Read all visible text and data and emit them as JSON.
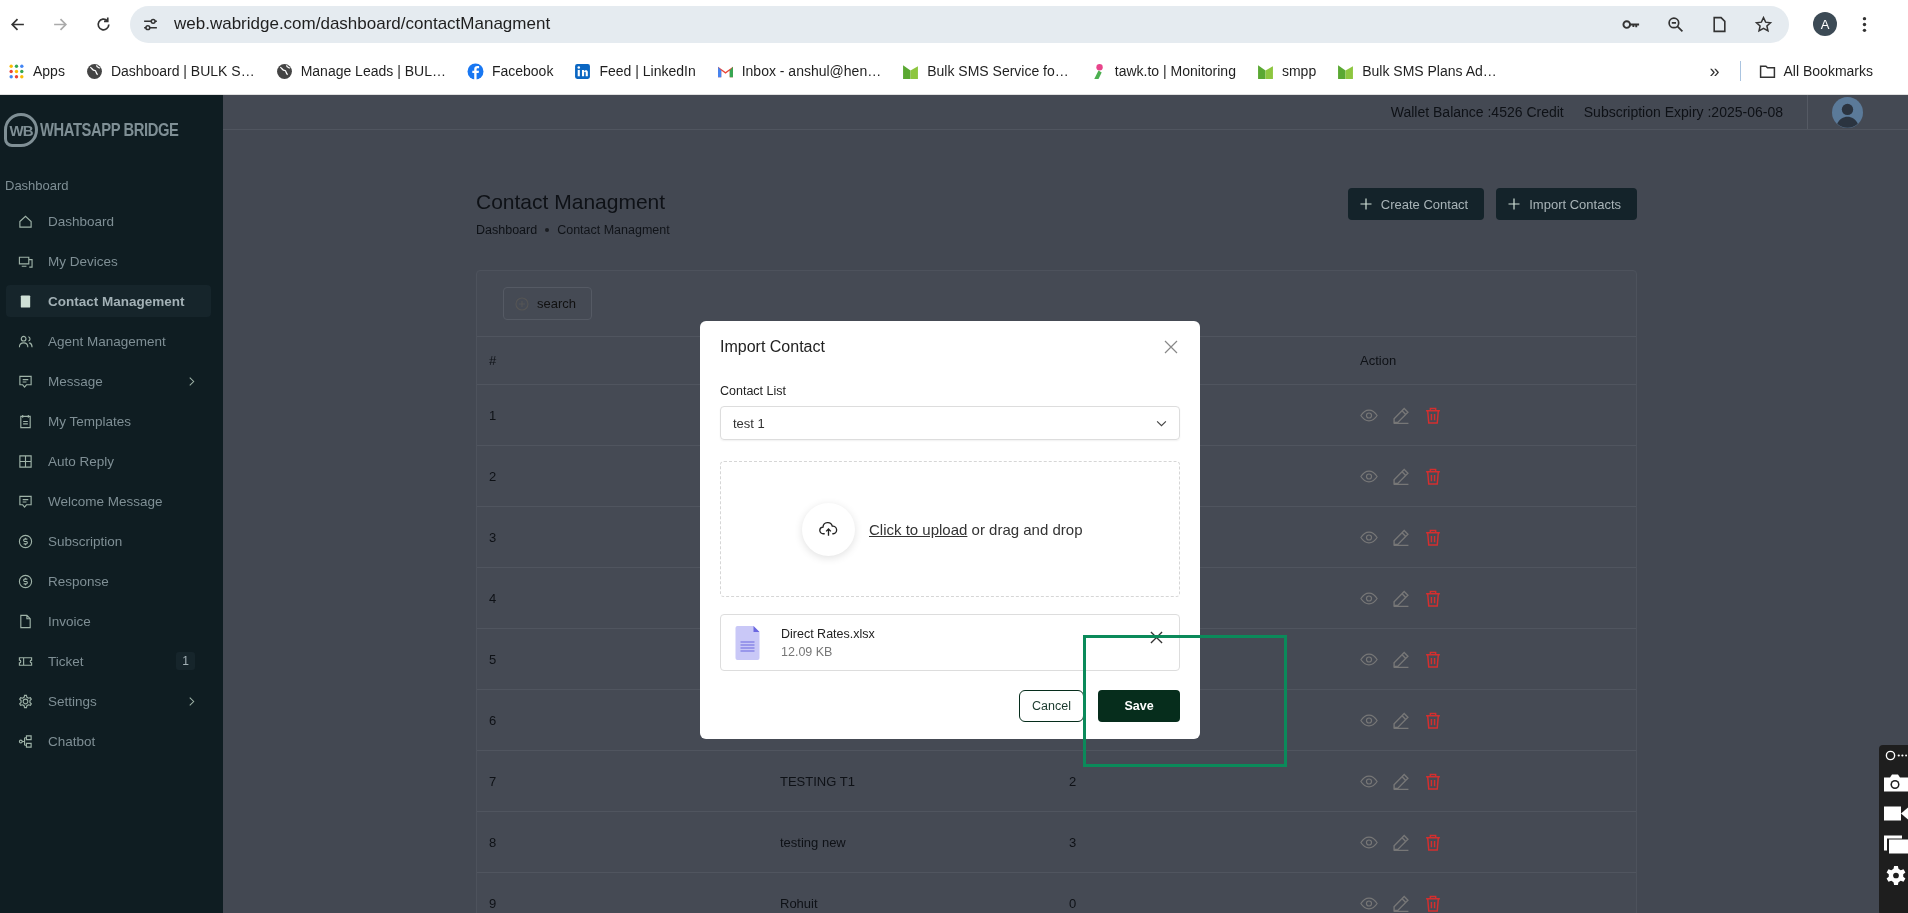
{
  "browser": {
    "url": "web.wabridge.com/dashboard/contactManagment",
    "profile_initial": "A",
    "bookmarks": [
      {
        "kind": "apps",
        "label": "Apps"
      },
      {
        "kind": "globe",
        "label": "Dashboard | BULK S…"
      },
      {
        "kind": "globe",
        "label": "Manage Leads | BUL…"
      },
      {
        "kind": "fb",
        "label": "Facebook"
      },
      {
        "kind": "in",
        "label": "Feed | LinkedIn"
      },
      {
        "kind": "mail",
        "label": "Inbox - anshul@hen…"
      },
      {
        "kind": "bs",
        "label": "Bulk SMS Service fo…"
      },
      {
        "kind": "tawk",
        "label": "tawk.to | Monitoring"
      },
      {
        "kind": "bs",
        "label": "smpp"
      },
      {
        "kind": "bs",
        "label": "Bulk SMS Plans Ad…"
      }
    ],
    "more": "»",
    "all_bookmarks": "All Bookmarks"
  },
  "app": {
    "brand_mark": "WB",
    "brand": "WHATSAPP BRIDGE",
    "sidebar": {
      "section": "Dashboard",
      "items": [
        {
          "label": "Dashboard",
          "selected": false,
          "submenu": false
        },
        {
          "label": "My Devices",
          "selected": false,
          "submenu": false
        },
        {
          "label": "Contact Management",
          "selected": true,
          "submenu": false
        },
        {
          "label": "Agent Management",
          "selected": false,
          "submenu": false
        },
        {
          "label": "Message",
          "selected": false,
          "submenu": true
        },
        {
          "label": "My Templates",
          "selected": false,
          "submenu": false
        },
        {
          "label": "Auto Reply",
          "selected": false,
          "submenu": false
        },
        {
          "label": "Welcome Message",
          "selected": false,
          "submenu": false
        },
        {
          "label": "Subscription",
          "selected": false,
          "submenu": false
        },
        {
          "label": "Response",
          "selected": false,
          "submenu": false
        },
        {
          "label": "Invoice",
          "selected": false,
          "submenu": false
        },
        {
          "label": "Ticket",
          "selected": false,
          "submenu": false,
          "badge": "1"
        },
        {
          "label": "Settings",
          "selected": false,
          "submenu": true
        },
        {
          "label": "Chatbot",
          "selected": false,
          "submenu": false
        }
      ]
    },
    "header": {
      "wallet": "Wallet Balance :4526 Credit",
      "expiry": "Subscription Expiry :2025-06-08"
    },
    "page": {
      "title": "Contact Managment",
      "breadcrumb": [
        "Dashboard",
        "Contact Managment"
      ],
      "buttons": [
        "Create Contact",
        "Import Contacts"
      ],
      "search_button": "search",
      "table": {
        "number_header": "#",
        "action_header": "Action",
        "rows": [
          {
            "number": "1"
          },
          {
            "number": "2"
          },
          {
            "number": "3"
          },
          {
            "number": "4"
          },
          {
            "number": "5"
          },
          {
            "number": "6"
          },
          {
            "number": "7",
            "column_2": "TESTING T1",
            "column_3": "2"
          },
          {
            "number": "8",
            "column_2": "testing new",
            "column_3": "3"
          },
          {
            "number": "9",
            "column_2": "Rohuit",
            "column_3": "0"
          }
        ]
      }
    }
  },
  "modal": {
    "title": "Import Contact",
    "field_label": "Contact List",
    "field_value": "test 1",
    "upload_link": "Click to upload",
    "upload_text": "or drag and drop",
    "file": {
      "name": "Direct Rates.xlsx",
      "size": "12.09 KB"
    },
    "buttons": {
      "cancel": "Cancel",
      "save": "Save"
    }
  }
}
